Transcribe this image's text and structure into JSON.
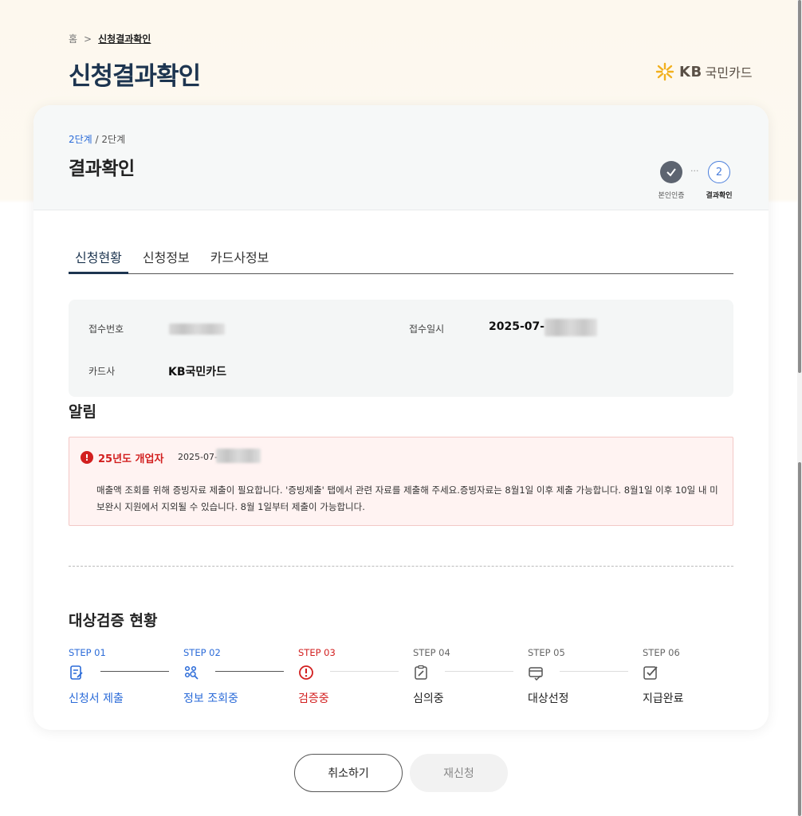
{
  "breadcrumb": {
    "home": "홈",
    "separator": ">",
    "current": "신청결과확인"
  },
  "page_title": "신청결과확인",
  "logo": {
    "kb": "KB",
    "name": "국민카드"
  },
  "card": {
    "stage_current": "2단계",
    "stage_total": "/ 2단계",
    "title": "결과확인",
    "stepper": {
      "step1_label": "본인인증",
      "step2_number": "2",
      "step2_label": "결과확인",
      "dots": "···"
    }
  },
  "tabs": [
    {
      "label": "신청현황"
    },
    {
      "label": "신청정보"
    },
    {
      "label": "카드사정보"
    }
  ],
  "info": {
    "receipt_no_label": "접수번호",
    "receipt_date_label": "접수일시",
    "receipt_date_value": "2025-07-",
    "card_company_label": "카드사",
    "card_company_value": "KB국민카드"
  },
  "notice": {
    "title": "알림",
    "icon": "!",
    "tag": "25년도 개업자",
    "date": "2025-07-",
    "message": "매출액 조회를 위해 증빙자료 제출이 필요합니다. '증빙제출' 탭에서 관련 자료를 제출해 주세요.증빙자료는 8월1일 이후 제출 가능합니다. 8월1일 이후 10일 내 미보완시 지원에서 지외될 수 있습니다. 8월 1일부터 제출이 가능합니다."
  },
  "progress": {
    "title": "대상검증 현황",
    "steps": [
      {
        "step": "STEP 01",
        "name": "신청서 제출",
        "icon": "document-pen-icon",
        "state": "done"
      },
      {
        "step": "STEP 02",
        "name": "정보 조회중",
        "icon": "search-dots-icon",
        "state": "done"
      },
      {
        "step": "STEP 03",
        "name": "검증중",
        "icon": "alert-circle-icon",
        "state": "error"
      },
      {
        "step": "STEP 04",
        "name": "심의중",
        "icon": "clipboard-pen-icon",
        "state": "pending"
      },
      {
        "step": "STEP 05",
        "name": "대상선정",
        "icon": "card-check-icon",
        "state": "pending"
      },
      {
        "step": "STEP 06",
        "name": "지급완료",
        "icon": "checkbox-icon",
        "state": "pending"
      }
    ]
  },
  "buttons": {
    "cancel": "취소하기",
    "reapply": "재신청"
  },
  "colors": {
    "primary": "#1d3550",
    "accent_blue": "#2b6bd8",
    "error_red": "#d21f1f"
  }
}
